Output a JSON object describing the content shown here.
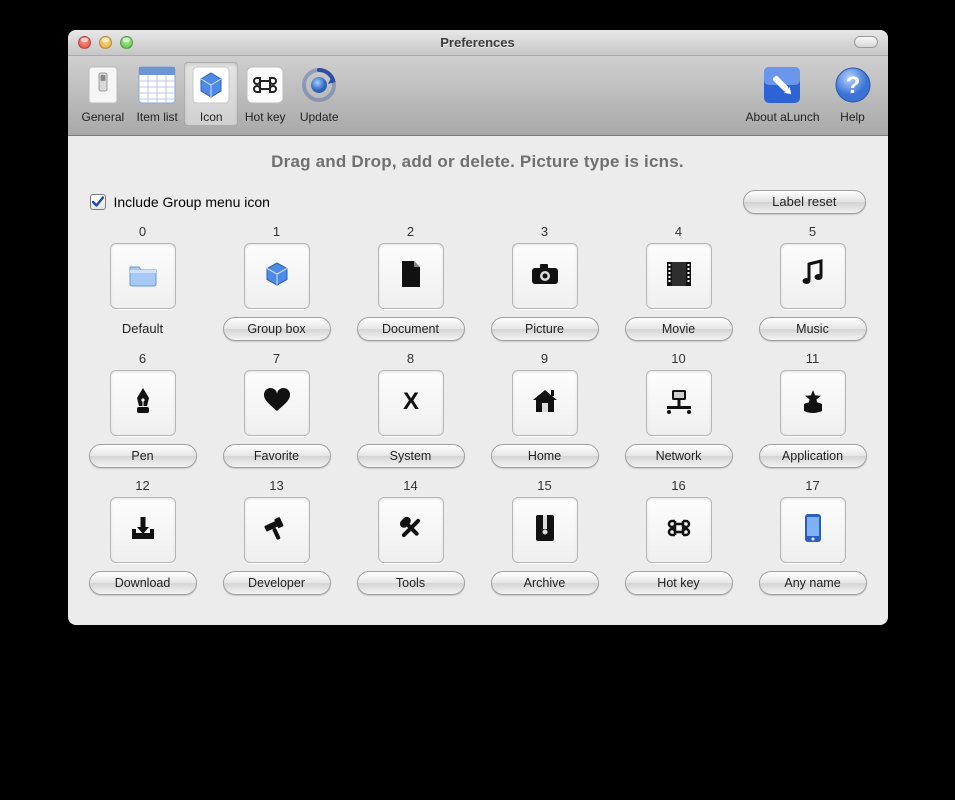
{
  "window": {
    "title": "Preferences"
  },
  "toolbar": {
    "general": "General",
    "item_list": "Item list",
    "icon": "Icon",
    "hot_key": "Hot key",
    "update": "Update",
    "about": "About aLunch",
    "help": "Help",
    "selected": "icon"
  },
  "instruction": "Drag and Drop, add or delete. Picture type is icns.",
  "controls": {
    "include_label": "Include Group menu icon",
    "include_checked": true,
    "reset_label": "Label reset"
  },
  "cells": [
    {
      "index": "0",
      "label": "Default",
      "icon": "folder",
      "color": "blue",
      "label_is_button": false
    },
    {
      "index": "1",
      "label": "Group box",
      "icon": "cube",
      "color": "blue",
      "label_is_button": true
    },
    {
      "index": "2",
      "label": "Document",
      "icon": "document",
      "label_is_button": true
    },
    {
      "index": "3",
      "label": "Picture",
      "icon": "camera",
      "label_is_button": true
    },
    {
      "index": "4",
      "label": "Movie",
      "icon": "film",
      "label_is_button": true
    },
    {
      "index": "5",
      "label": "Music",
      "icon": "music",
      "label_is_button": true
    },
    {
      "index": "6",
      "label": "Pen",
      "icon": "pen",
      "label_is_button": true
    },
    {
      "index": "7",
      "label": "Favorite",
      "icon": "heart",
      "label_is_button": true
    },
    {
      "index": "8",
      "label": "System",
      "icon": "system",
      "label_is_button": true
    },
    {
      "index": "9",
      "label": "Home",
      "icon": "home",
      "label_is_button": true
    },
    {
      "index": "10",
      "label": "Network",
      "icon": "network",
      "label_is_button": true
    },
    {
      "index": "11",
      "label": "Application",
      "icon": "app",
      "label_is_button": true
    },
    {
      "index": "12",
      "label": "Download",
      "icon": "download",
      "label_is_button": true
    },
    {
      "index": "13",
      "label": "Developer",
      "icon": "hammer",
      "label_is_button": true
    },
    {
      "index": "14",
      "label": "Tools",
      "icon": "tools",
      "label_is_button": true
    },
    {
      "index": "15",
      "label": "Archive",
      "icon": "archive",
      "label_is_button": true
    },
    {
      "index": "16",
      "label": "Hot key",
      "icon": "command",
      "label_is_button": true
    },
    {
      "index": "17",
      "label": "Any name",
      "icon": "phone",
      "color": "blue",
      "label_is_button": true
    }
  ]
}
